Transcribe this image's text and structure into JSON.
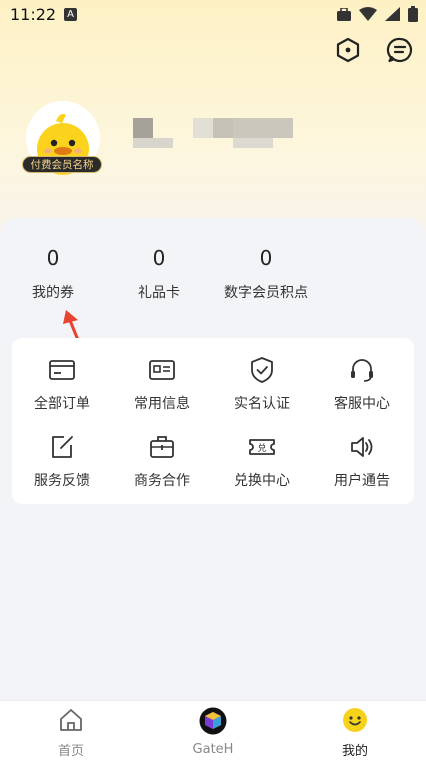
{
  "status_bar": {
    "time": "11:22",
    "a_glyph": "A"
  },
  "profile": {
    "member_badge": "付费会员名称"
  },
  "stats": [
    {
      "value": "0",
      "label": "我的券"
    },
    {
      "value": "0",
      "label": "礼品卡"
    },
    {
      "value": "0",
      "label": "数字会员积点"
    }
  ],
  "grid": [
    {
      "label": "全部订单",
      "icon": "card-icon"
    },
    {
      "label": "常用信息",
      "icon": "id-card-icon"
    },
    {
      "label": "实名认证",
      "icon": "shield-check-icon"
    },
    {
      "label": "客服中心",
      "icon": "headset-icon"
    },
    {
      "label": "服务反馈",
      "icon": "edit-icon"
    },
    {
      "label": "商务合作",
      "icon": "briefcase-icon"
    },
    {
      "label": "兑换中心",
      "icon": "exchange-ticket-icon"
    },
    {
      "label": "用户通告",
      "icon": "speaker-icon"
    }
  ],
  "bottom_nav": [
    {
      "label": "首页",
      "icon": "home-icon",
      "active": false
    },
    {
      "label": "GateH",
      "icon": "cube-icon",
      "active": false
    },
    {
      "label": "我的",
      "icon": "smiley-icon",
      "active": true
    }
  ],
  "colors": {
    "accent_yellow": "#f7d21b",
    "annotation_arrow": "#e8432e"
  }
}
